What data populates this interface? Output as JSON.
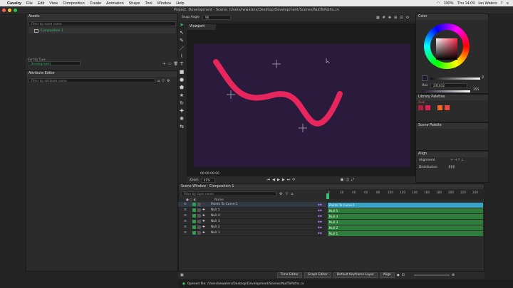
{
  "menubar": {
    "app": "Cavalry",
    "items": [
      "File",
      "Edit",
      "View",
      "Composition",
      "Create",
      "Animation",
      "Shape",
      "Tool",
      "Window",
      "Help"
    ],
    "battery": "100%",
    "clock": "Thu 14:09",
    "user": "Ian Waters"
  },
  "window_title": "Project: Development - Scene: /Users/iwwaters/Desktop/Development/Scenes/NullToPaths.cv",
  "assets": {
    "title": "Assets",
    "search_placeholder": "Filter by asset name",
    "item": "Composition 1",
    "sort_label": "Sort by Type",
    "sort_value": "Development"
  },
  "attribute_editor": {
    "title": "Attribute Editor",
    "search_placeholder": "Filter by attribute name"
  },
  "viewport": {
    "snap_label": "Snap Angle",
    "snap_value": "90",
    "title": "Viewport",
    "timecode": "00:00:00:00",
    "zoom_label": "Zoom",
    "zoom_value": "41%"
  },
  "color": {
    "title": "Color",
    "hex_label": "Hex",
    "hex_value": "231632",
    "alpha_value": "255",
    "library_title": "Library Palettes",
    "palette_name": "Audi",
    "scene_title": "Scene Palette",
    "swatches": [
      "#b01e3a",
      "#e02050",
      "#f06a2a",
      "#e84a3a",
      "#b33a3a"
    ]
  },
  "align": {
    "title": "Align",
    "alignment_label": "Alignment",
    "distribution_label": "Distribution"
  },
  "scene_window": {
    "title": "Scene Window - Composition 1",
    "search_placeholder": "Filter by layer name",
    "name_header": "Name",
    "layers": [
      "Points To Curve 1",
      "Null 5",
      "Null 4",
      "Null 3",
      "Null 2",
      "Null 1"
    ]
  },
  "timeline": {
    "ticks": [
      "0",
      "20",
      "40",
      "60",
      "80",
      "100",
      "120",
      "140",
      "160",
      "180",
      "200",
      "220",
      "240"
    ],
    "time_editor": "Time Editor",
    "graph_editor": "Graph Editor",
    "default_keyframe": "Default Keyframe Layer",
    "align_label": "Align"
  },
  "status": "Opened file: /Users/iwwaters/Desktop/Development/Scenes/NullToPaths.cv",
  "accent": "#35c26a",
  "canvas_bg": "#2a1a3c",
  "curve_color": "#e8265e"
}
